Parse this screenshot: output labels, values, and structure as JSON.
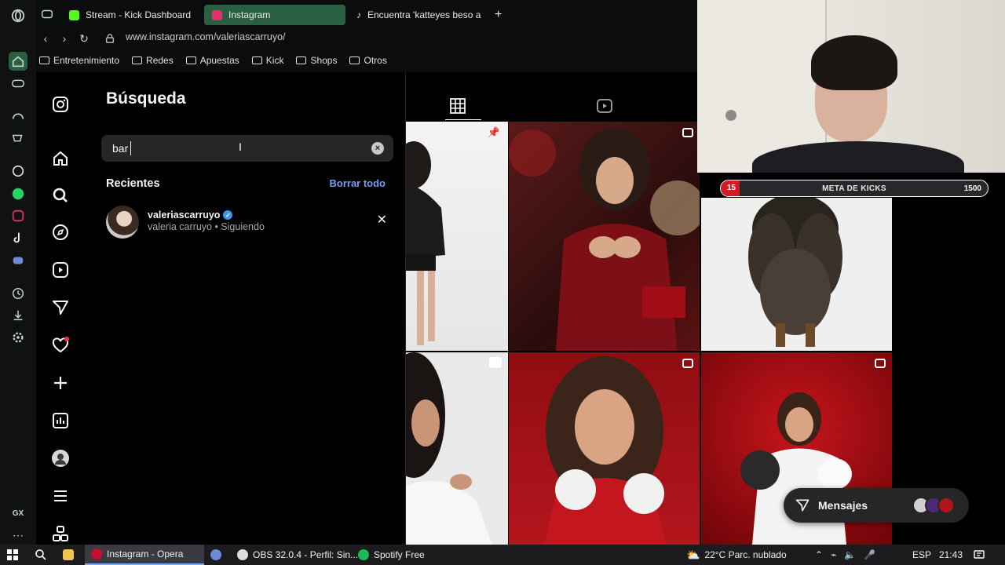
{
  "browser": {
    "tabs": [
      {
        "label": "Stream - Kick Dashboard",
        "favicon_color": "#53fc18"
      },
      {
        "label": "Instagram",
        "favicon_color": "#e1306c"
      },
      {
        "label": "Encuentra 'katteyes beso a",
        "favicon_color": "#ffffff"
      }
    ],
    "new_tab_label": "+",
    "url": "www.instagram.com/valeriascarruyo/",
    "bookmarks": [
      "Entretenimiento",
      "Redes",
      "Apuestas",
      "Kick",
      "Shops",
      "Otros"
    ],
    "sidebar_badge": "GX"
  },
  "search": {
    "title": "Búsqueda",
    "query": "bar",
    "clear_label": "×",
    "recents_label": "Recientes",
    "clear_all_label": "Borrar todo",
    "recent_items": [
      {
        "username": "valeriascarruyo",
        "subtitle": "valeria carruyo • Siguiendo",
        "verified": true
      }
    ],
    "remove_label": "✕"
  },
  "kick_goal": {
    "current": "15",
    "label": "META DE KICKS",
    "target": "1500",
    "progress": 0.01,
    "color": "#d21c24"
  },
  "messages": {
    "label": "Mensajes"
  },
  "taskbar": {
    "items": [
      {
        "label": "Instagram - Opera",
        "color": "#c8102e"
      },
      {
        "label": "OBS 32.0.4 - Perfil: Sin...",
        "color": "#dddddd"
      },
      {
        "label": "Spotify Free",
        "color": "#1db954"
      }
    ],
    "weather": "22°C  Parc. nublado",
    "lang": "ESP",
    "time": "21:43"
  }
}
